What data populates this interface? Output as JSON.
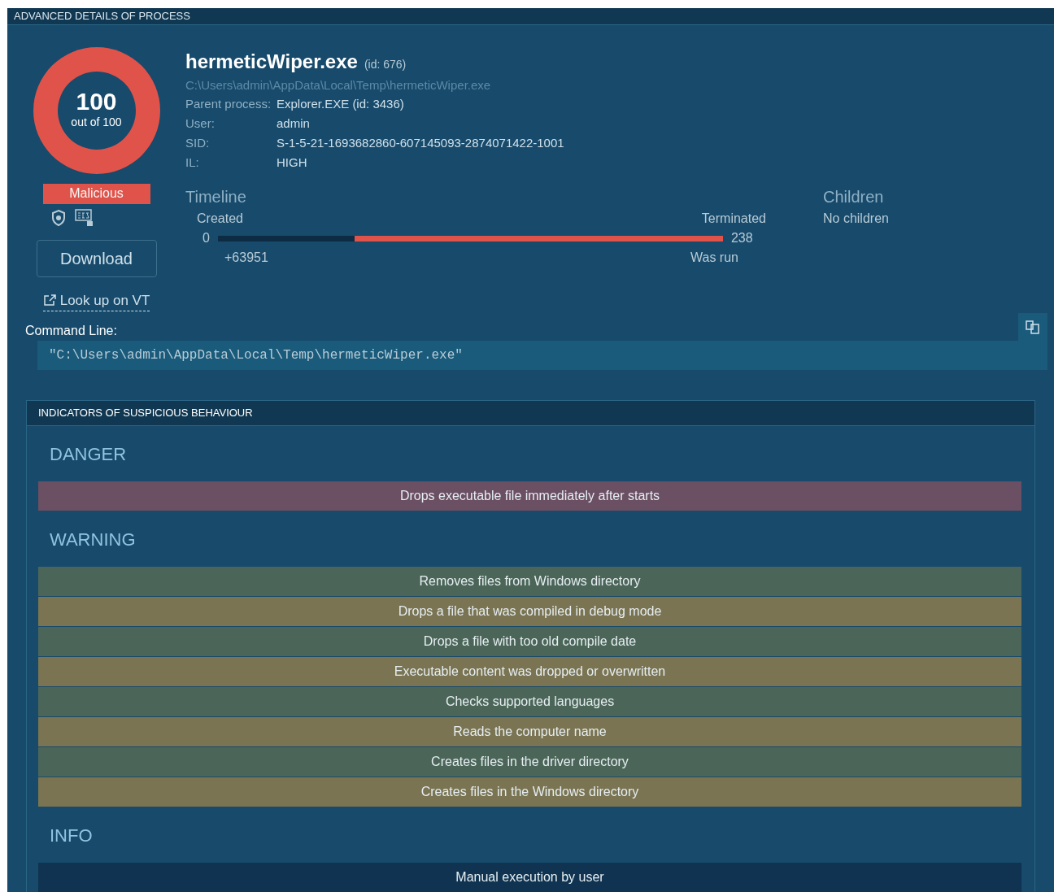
{
  "panel_title": "ADVANCED DETAILS OF PROCESS",
  "score": {
    "value": "100",
    "caption": "out of 100",
    "verdict": "Malicious"
  },
  "download_button": "Download",
  "vt_link": "Look up on VT",
  "process": {
    "name": "hermeticWiper.exe",
    "id": "(id: 676)",
    "path": "C:\\Users\\admin\\AppData\\Local\\Temp\\hermeticWiper.exe",
    "fields": [
      {
        "label": "Parent process:",
        "value": "Explorer.EXE (id: 3436)"
      },
      {
        "label": "User:",
        "value": "admin"
      },
      {
        "label": "SID:",
        "value": "S-1-5-21-1693682860-607145093-2874071422-1001"
      },
      {
        "label": "IL:",
        "value": "HIGH"
      }
    ]
  },
  "timeline": {
    "title": "Timeline",
    "created_label": "Created",
    "start": "0",
    "offset": "+63951",
    "terminated_label": "Terminated",
    "end": "238",
    "end_note": "Was run",
    "level": 0.73
  },
  "children": {
    "title": "Children",
    "value": "No children"
  },
  "command_line": {
    "label": "Command Line:",
    "value": "\"C:\\Users\\admin\\AppData\\Local\\Temp\\hermeticWiper.exe\""
  },
  "indicators": {
    "title": "INDICATORS OF SUSPICIOUS BEHAVIOUR",
    "groups": [
      {
        "kind": "danger",
        "title": "DANGER",
        "items": [
          "Drops executable file immediately after starts"
        ]
      },
      {
        "kind": "warning",
        "title": "WARNING",
        "items": [
          "Removes files from Windows directory",
          "Drops a file that was compiled in debug mode",
          "Drops a file with too old compile date",
          "Executable content was dropped or overwritten",
          "Checks supported languages",
          "Reads the computer name",
          "Creates files in the driver directory",
          "Creates files in the Windows directory"
        ]
      },
      {
        "kind": "info",
        "title": "INFO",
        "items": [
          "Manual execution by user"
        ]
      }
    ]
  }
}
